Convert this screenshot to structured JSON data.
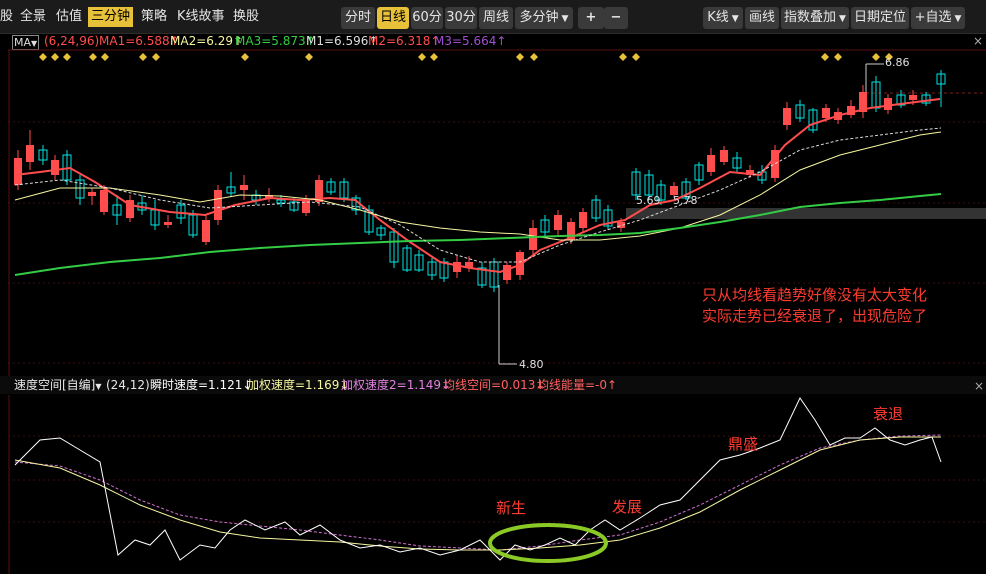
{
  "toolbar": {
    "left_tabs": [
      "股",
      "全景",
      "估值",
      "三分钟",
      "策略",
      "K线故事",
      "换股"
    ],
    "active_tab": "三分钟",
    "period_buttons": [
      "分时",
      "日线",
      "60分",
      "30分",
      "周线",
      "多分钟"
    ],
    "active_period": "日线",
    "plus": "+",
    "minus": "−",
    "kline_dropdown": "K线",
    "draw_line": "画线",
    "indicator_overlay": "指数叠加",
    "date_locate": "日期定位",
    "add_watch": "+自选"
  },
  "ma_bar": {
    "selector": "MA",
    "params": "(6,24,96)",
    "ma1": "MA1=6.588↑",
    "ma2": "MA2=6.29↑",
    "ma3": "MA3=5.873↑",
    "m1": "M1=6.596↑",
    "m2": "M2=6.318↑",
    "m3": "M3=5.664↑",
    "close": "×"
  },
  "price_labels": {
    "high": "6.86",
    "low": "4.80",
    "mid1": "5.69",
    "mid2": "5.78"
  },
  "annotation_main": [
    "只从均线看趋势好像没有太大变化",
    "实际走势已经衰退了，出现危险了"
  ],
  "indicator_bar": {
    "name": "速度空间[自编]",
    "params": "(24,12)",
    "v1": "瞬时速度=1.121↓",
    "v2": "加权速度=1.169↓",
    "v3": "加权速度2=1.149↓",
    "v4": "均线空间=0.013↓",
    "v5": "均线能量=-0↑",
    "close": "×"
  },
  "phases": {
    "born": "新生",
    "develop": "发展",
    "peak": "鼎盛",
    "decline": "衰退"
  },
  "colors": {
    "up": "#ff4d4d",
    "down": "#00e5e5",
    "ma1": "#ff4d4d",
    "ma2": "#f6f6a0",
    "ma3": "#33cc44",
    "accent": "#e8c13a",
    "annotation": "#ff3b30",
    "ellipse": "#8ac926"
  }
}
